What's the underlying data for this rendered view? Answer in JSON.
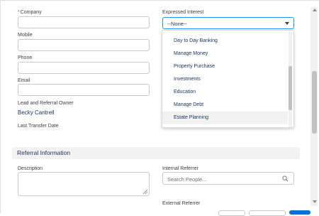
{
  "form": {
    "company_label": "Company",
    "company_required": "*",
    "mobile_label": "Mobile",
    "phone_label": "Phone",
    "email_label": "Email",
    "owner_label": "Lead and Referral Owner",
    "owner_value": "Becky Cantrell",
    "last_transfer_label": "Last Transfer Date",
    "interest_label": "Expressed Interest",
    "interest_selected": "--None--",
    "interest_options": [
      "Day to Day Banking",
      "Manage Money",
      "Property Purchase",
      "Investments",
      "Education",
      "Manage Debt",
      "Estate Planning"
    ]
  },
  "referral_section": {
    "title": "Referral Information",
    "description_label": "Description",
    "internal_referrer_label": "Internal Referrer",
    "internal_referrer_placeholder": "Search People...",
    "external_referrer_label": "External Referrer"
  },
  "icons": {
    "dropdown": "chevron-down-icon",
    "search": "search-icon"
  }
}
